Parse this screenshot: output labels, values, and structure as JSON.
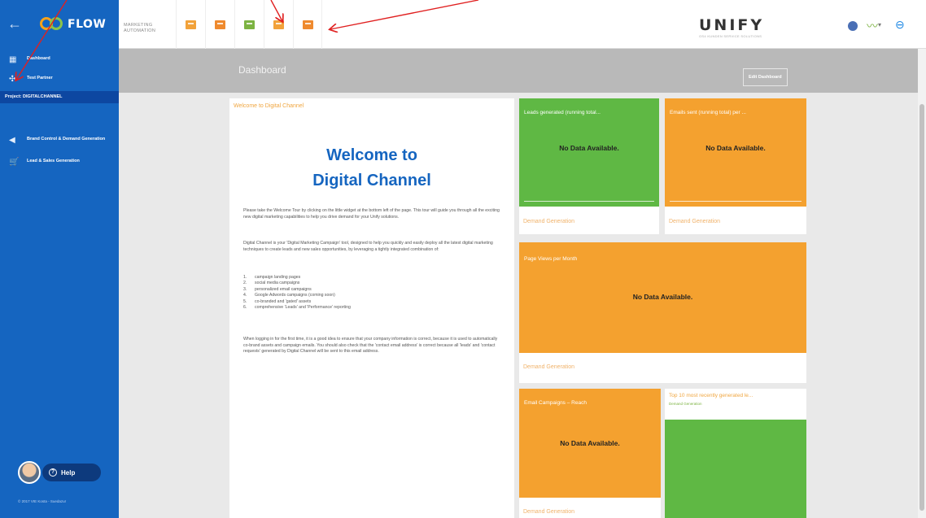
{
  "topbar": {
    "brand_name": "FLOW",
    "section_caption": "MARKETING AUTOMATION",
    "tools": [
      {
        "name": "briefcase-tool",
        "color": "#f2a23a"
      },
      {
        "name": "chat-tool",
        "color": "#ef8a2e"
      },
      {
        "name": "user-card-tool",
        "color": "#7cb342"
      },
      {
        "name": "email-tool",
        "color": "#f2a23a"
      },
      {
        "name": "document-tool",
        "color": "#ef8a2e"
      }
    ],
    "logo": "UNIFY",
    "logo_sub": "OS4 KUNDEN SERVICE SOLUTIONS",
    "back_glyph": "←",
    "stats_glyph": "〰",
    "caret_glyph": "▾",
    "logout_glyph": "⊖"
  },
  "sidebar": {
    "items": [
      {
        "label": "Dashboard",
        "icon": "dashboard-icon",
        "glyph": "▦"
      },
      {
        "label": "Test Partner",
        "icon": "partner-icon",
        "glyph": "✣"
      }
    ],
    "project": "Project: DIGITALCHANNEL",
    "nav": [
      {
        "label": "Brand Control & Demand Generation",
        "icon": "megaphone-icon",
        "glyph": "◀"
      },
      {
        "label": "Lead & Sales Generation",
        "icon": "cart-icon",
        "glyph": "🛒"
      }
    ],
    "help_label": "Help",
    "help_glyph": "?",
    "copyright": "© 2017 VIE Kosta - Suedazur"
  },
  "header": {
    "title": "Dashboard",
    "edit_button": "Edit Dashboard"
  },
  "welcome": {
    "header": "Welcome to Digital Channel",
    "title_line1": "Welcome to",
    "title_line2": "Digital Channel",
    "para1": "Please take the Welcome Tour by clicking on the little widget at the bottom left of the page. This tour will guide you through all the exciting new digital marketing capabilities to help you drive demand for your Unify solutions.",
    "para2": "Digital Channel is your 'Digital Marketing Campaign' tool, designed to help you quickly and easily deploy all the latest digital marketing techniques to create leads and new sales opportunities, by leveraging a tightly integrated combination of:",
    "list": [
      {
        "num": "1.",
        "text": "campaign landing pages"
      },
      {
        "num": "2.",
        "text": "social media campaigns"
      },
      {
        "num": "3.",
        "text": "personalized email campaigns"
      },
      {
        "num": "4.",
        "text": "Google Adwords campaigns (coming soon)"
      },
      {
        "num": "5.",
        "text": "co-branded and 'gated' assets"
      },
      {
        "num": "6.",
        "text": "comprehensive 'Leads' and 'Performance' reporting"
      }
    ],
    "para3": "When logging in for the first time, it is a good idea to ensure that your company information is correct, because it is used to automatically co-brand assets and campaign emails. You should also check that the 'contact email address' is correct because all 'leads' and 'contact requests' generated by Digital Channel will be sent to this email address."
  },
  "widgets": {
    "no_data": "No Data Available.",
    "footer": "Demand Generation",
    "leads_title": "Leads generated (running total...",
    "emails_title": "Emails sent (running total) per ...",
    "pageviews_title": "Page Views per Month",
    "reach_title": "Email Campaigns – Reach",
    "top10_title": "Top 10 most recently generated le...",
    "top10_sub": "Demand Generation"
  },
  "colors": {
    "sidebar": "#1565c0",
    "green": "#5fb844",
    "orange": "#f4a12f",
    "annotation_arrow": "#e02020"
  }
}
